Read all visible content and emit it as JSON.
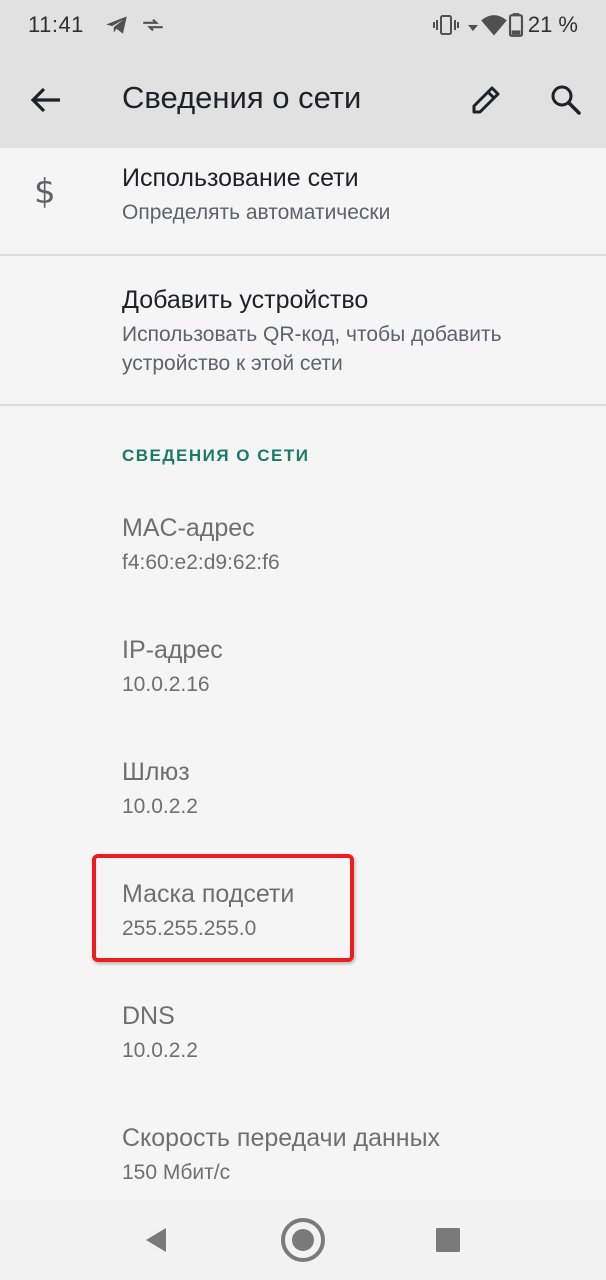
{
  "status_bar": {
    "time": "11:41",
    "battery_percent": "21 %"
  },
  "app_bar": {
    "title": "Сведения о сети"
  },
  "items": {
    "usage": {
      "title": "Использование сети",
      "subtitle": "Определять автоматически"
    },
    "add_device": {
      "title": "Добавить устройство",
      "subtitle": "Использовать QR-код, чтобы добавить устройство к этой сети"
    }
  },
  "section": {
    "title": "СВЕДЕНИЯ О СЕТИ"
  },
  "details": [
    {
      "label": "MAC-адрес",
      "value": "f4:60:e2:d9:62:f6"
    },
    {
      "label": "IP-адрес",
      "value": "10.0.2.16"
    },
    {
      "label": "Шлюз",
      "value": "10.0.2.2"
    },
    {
      "label": "Маска подсети",
      "value": "255.255.255.0"
    },
    {
      "label": "DNS",
      "value": "10.0.2.2"
    },
    {
      "label": "Скорость передачи данных",
      "value": "150 Мбит/с"
    }
  ],
  "colors": {
    "accent": "#1b7a68",
    "highlight": "#ee1c1c",
    "app_bar_bg": "#e1e1e1"
  }
}
